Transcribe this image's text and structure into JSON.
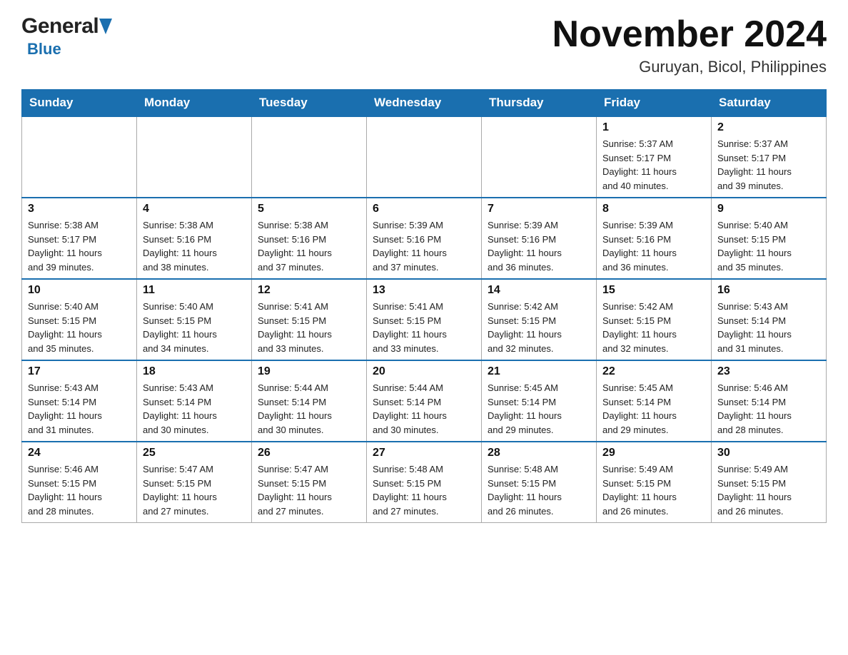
{
  "header": {
    "logo_general": "General",
    "logo_blue": "Blue",
    "month_title": "November 2024",
    "location": "Guruyan, Bicol, Philippines"
  },
  "weekdays": [
    "Sunday",
    "Monday",
    "Tuesday",
    "Wednesday",
    "Thursday",
    "Friday",
    "Saturday"
  ],
  "weeks": [
    {
      "days": [
        {
          "number": "",
          "info": ""
        },
        {
          "number": "",
          "info": ""
        },
        {
          "number": "",
          "info": ""
        },
        {
          "number": "",
          "info": ""
        },
        {
          "number": "",
          "info": ""
        },
        {
          "number": "1",
          "info": "Sunrise: 5:37 AM\nSunset: 5:17 PM\nDaylight: 11 hours\nand 40 minutes."
        },
        {
          "number": "2",
          "info": "Sunrise: 5:37 AM\nSunset: 5:17 PM\nDaylight: 11 hours\nand 39 minutes."
        }
      ]
    },
    {
      "days": [
        {
          "number": "3",
          "info": "Sunrise: 5:38 AM\nSunset: 5:17 PM\nDaylight: 11 hours\nand 39 minutes."
        },
        {
          "number": "4",
          "info": "Sunrise: 5:38 AM\nSunset: 5:16 PM\nDaylight: 11 hours\nand 38 minutes."
        },
        {
          "number": "5",
          "info": "Sunrise: 5:38 AM\nSunset: 5:16 PM\nDaylight: 11 hours\nand 37 minutes."
        },
        {
          "number": "6",
          "info": "Sunrise: 5:39 AM\nSunset: 5:16 PM\nDaylight: 11 hours\nand 37 minutes."
        },
        {
          "number": "7",
          "info": "Sunrise: 5:39 AM\nSunset: 5:16 PM\nDaylight: 11 hours\nand 36 minutes."
        },
        {
          "number": "8",
          "info": "Sunrise: 5:39 AM\nSunset: 5:16 PM\nDaylight: 11 hours\nand 36 minutes."
        },
        {
          "number": "9",
          "info": "Sunrise: 5:40 AM\nSunset: 5:15 PM\nDaylight: 11 hours\nand 35 minutes."
        }
      ]
    },
    {
      "days": [
        {
          "number": "10",
          "info": "Sunrise: 5:40 AM\nSunset: 5:15 PM\nDaylight: 11 hours\nand 35 minutes."
        },
        {
          "number": "11",
          "info": "Sunrise: 5:40 AM\nSunset: 5:15 PM\nDaylight: 11 hours\nand 34 minutes."
        },
        {
          "number": "12",
          "info": "Sunrise: 5:41 AM\nSunset: 5:15 PM\nDaylight: 11 hours\nand 33 minutes."
        },
        {
          "number": "13",
          "info": "Sunrise: 5:41 AM\nSunset: 5:15 PM\nDaylight: 11 hours\nand 33 minutes."
        },
        {
          "number": "14",
          "info": "Sunrise: 5:42 AM\nSunset: 5:15 PM\nDaylight: 11 hours\nand 32 minutes."
        },
        {
          "number": "15",
          "info": "Sunrise: 5:42 AM\nSunset: 5:15 PM\nDaylight: 11 hours\nand 32 minutes."
        },
        {
          "number": "16",
          "info": "Sunrise: 5:43 AM\nSunset: 5:14 PM\nDaylight: 11 hours\nand 31 minutes."
        }
      ]
    },
    {
      "days": [
        {
          "number": "17",
          "info": "Sunrise: 5:43 AM\nSunset: 5:14 PM\nDaylight: 11 hours\nand 31 minutes."
        },
        {
          "number": "18",
          "info": "Sunrise: 5:43 AM\nSunset: 5:14 PM\nDaylight: 11 hours\nand 30 minutes."
        },
        {
          "number": "19",
          "info": "Sunrise: 5:44 AM\nSunset: 5:14 PM\nDaylight: 11 hours\nand 30 minutes."
        },
        {
          "number": "20",
          "info": "Sunrise: 5:44 AM\nSunset: 5:14 PM\nDaylight: 11 hours\nand 30 minutes."
        },
        {
          "number": "21",
          "info": "Sunrise: 5:45 AM\nSunset: 5:14 PM\nDaylight: 11 hours\nand 29 minutes."
        },
        {
          "number": "22",
          "info": "Sunrise: 5:45 AM\nSunset: 5:14 PM\nDaylight: 11 hours\nand 29 minutes."
        },
        {
          "number": "23",
          "info": "Sunrise: 5:46 AM\nSunset: 5:14 PM\nDaylight: 11 hours\nand 28 minutes."
        }
      ]
    },
    {
      "days": [
        {
          "number": "24",
          "info": "Sunrise: 5:46 AM\nSunset: 5:15 PM\nDaylight: 11 hours\nand 28 minutes."
        },
        {
          "number": "25",
          "info": "Sunrise: 5:47 AM\nSunset: 5:15 PM\nDaylight: 11 hours\nand 27 minutes."
        },
        {
          "number": "26",
          "info": "Sunrise: 5:47 AM\nSunset: 5:15 PM\nDaylight: 11 hours\nand 27 minutes."
        },
        {
          "number": "27",
          "info": "Sunrise: 5:48 AM\nSunset: 5:15 PM\nDaylight: 11 hours\nand 27 minutes."
        },
        {
          "number": "28",
          "info": "Sunrise: 5:48 AM\nSunset: 5:15 PM\nDaylight: 11 hours\nand 26 minutes."
        },
        {
          "number": "29",
          "info": "Sunrise: 5:49 AM\nSunset: 5:15 PM\nDaylight: 11 hours\nand 26 minutes."
        },
        {
          "number": "30",
          "info": "Sunrise: 5:49 AM\nSunset: 5:15 PM\nDaylight: 11 hours\nand 26 minutes."
        }
      ]
    }
  ]
}
